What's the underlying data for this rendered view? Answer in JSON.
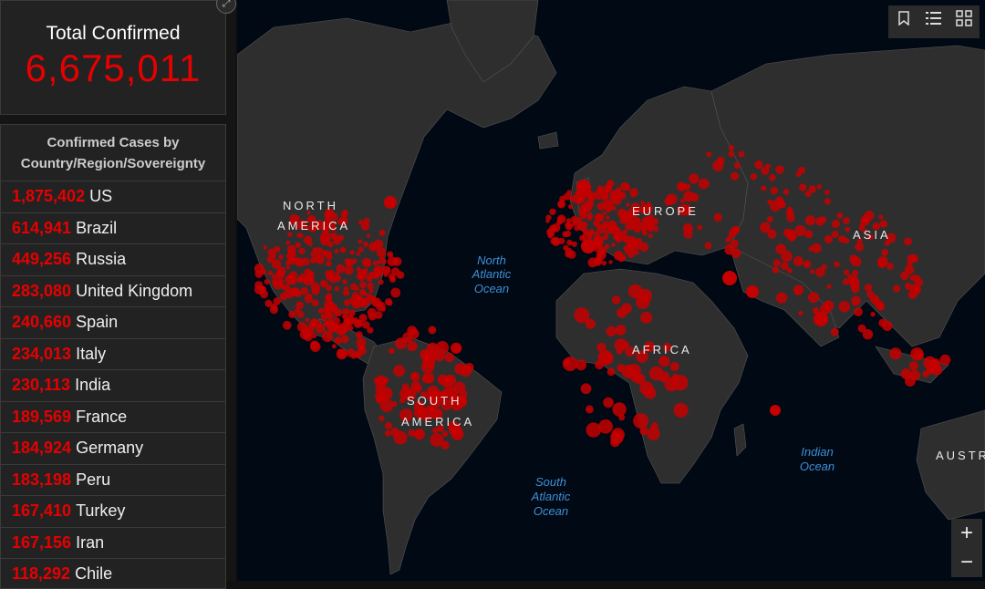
{
  "total": {
    "title": "Total Confirmed",
    "value": "6,675,011"
  },
  "list": {
    "title_line1": "Confirmed Cases by",
    "title_line2": "Country/Region/Sovereignty",
    "rows": [
      {
        "cases": "1,875,402",
        "country": "US"
      },
      {
        "cases": "614,941",
        "country": "Brazil"
      },
      {
        "cases": "449,256",
        "country": "Russia"
      },
      {
        "cases": "283,080",
        "country": "United Kingdom"
      },
      {
        "cases": "240,660",
        "country": "Spain"
      },
      {
        "cases": "234,013",
        "country": "Italy"
      },
      {
        "cases": "230,113",
        "country": "India"
      },
      {
        "cases": "189,569",
        "country": "France"
      },
      {
        "cases": "184,924",
        "country": "Germany"
      },
      {
        "cases": "183,198",
        "country": "Peru"
      },
      {
        "cases": "167,410",
        "country": "Turkey"
      },
      {
        "cases": "167,156",
        "country": "Iran"
      },
      {
        "cases": "118,292",
        "country": "Chile"
      }
    ]
  },
  "map": {
    "continent_labels": {
      "north_america_1": "NORTH",
      "north_america_2": "AMERICA",
      "europe": "EUROPE",
      "asia": "ASIA",
      "africa": "AFRICA",
      "south_america_1": "SOUTH",
      "south_america_2": "AMERICA",
      "australia": "AUSTR"
    },
    "ocean_labels": {
      "north_atlantic": [
        "North",
        "Atlantic",
        "Ocean"
      ],
      "south_atlantic": [
        "South",
        "Atlantic",
        "Ocean"
      ],
      "indian": [
        "Indian",
        "Ocean"
      ]
    }
  },
  "toolbar": {
    "icons": [
      "bookmark-icon",
      "list-icon",
      "qr-grid-icon"
    ]
  },
  "zoom": {
    "in_label": "+",
    "out_label": "−"
  },
  "colors": {
    "case_red": "#e60000",
    "dot_red": "#c40000",
    "land": "#2e2e2e",
    "ocean": "#000914",
    "ocean_label": "#3e8fd8",
    "panel": "#222222"
  }
}
